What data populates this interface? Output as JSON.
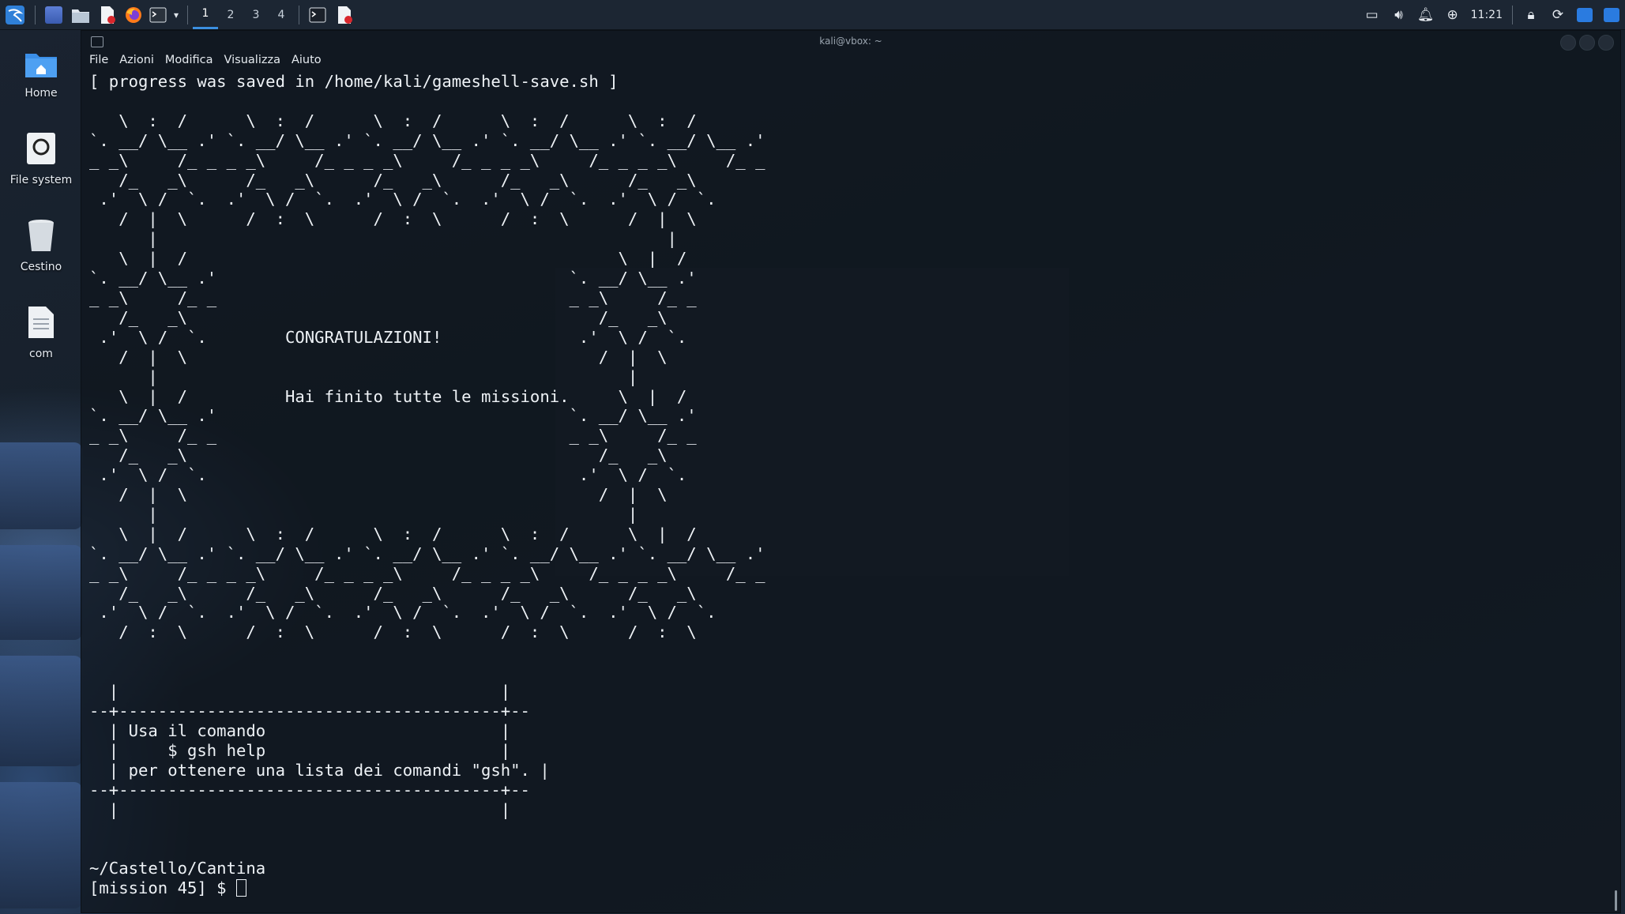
{
  "panel": {
    "workspaces": [
      "1",
      "2",
      "3",
      "4"
    ],
    "active_workspace": "1",
    "clock": "11:21",
    "launchers": [
      "kali-menu-icon",
      "show-desktop-icon",
      "file-manager-icon",
      "text-editor-icon",
      "firefox-icon",
      "terminal-icon"
    ],
    "tray_icons": [
      "display-icon",
      "volume-icon",
      "notification-bell-icon",
      "update-icon",
      "lock-icon",
      "refresh-icon",
      "tray-app-icon",
      "tray-app-icon-2"
    ]
  },
  "desktop": {
    "icons": [
      {
        "label": "Home",
        "icon": "home-folder-icon"
      },
      {
        "label": "File system",
        "icon": "file-system-icon"
      },
      {
        "label": "Cestino",
        "icon": "trash-icon"
      },
      {
        "label": "com",
        "icon": "text-file-icon"
      }
    ]
  },
  "terminal": {
    "title": "kali@vbox: ~",
    "menu": [
      "File",
      "Azioni",
      "Modifica",
      "Visualizza",
      "Aiuto"
    ],
    "lines": [
      "[ progress was saved in /home/kali/gameshell-save.sh ]",
      "",
      "   \\  :  /      \\  :  /      \\  :  /      \\  :  /      \\  :  /",
      "`. __/ \\__ .' `. __/ \\__ .' `. __/ \\__ .' `. __/ \\__ .' `. __/ \\__ .'",
      "_ _\\     /_ _ _ _\\     /_ _ _ _\\     /_ _ _ _\\     /_ _ _ _\\     /_ _",
      "   /_   _\\      /_   _\\      /_   _\\      /_   _\\      /_   _\\",
      " .'  \\ /  `.  .'  \\ /  `.  .'  \\ /  `.  .'  \\ /  `.  .'  \\ /  `.",
      "   /  |  \\      /  :  \\      /  :  \\      /  :  \\      /  |  \\",
      "      |                                                    |",
      "   \\  |  /                                            \\  |  /",
      "`. __/ \\__ .'                                    `. __/ \\__ .'",
      "_ _\\     /_ _                                    _ _\\     /_ _",
      "   /_   _\\                                          /_   _\\",
      " .'  \\ /  `.        CONGRATULAZIONI!              .'  \\ /  `.",
      "   /  |  \\                                          /  |  \\",
      "      |                                                |",
      "   \\  |  /          Hai finito tutte le missioni.     \\  |  /",
      "`. __/ \\__ .'                                    `. __/ \\__ .'",
      "_ _\\     /_ _                                    _ _\\     /_ _",
      "   /_   _\\                                          /_   _\\",
      " .'  \\ /  `.                                      .'  \\ /  `.",
      "   /  |  \\                                          /  |  \\",
      "      |                                                |",
      "   \\  |  /      \\  :  /      \\  :  /      \\  :  /      \\  |  /",
      "`. __/ \\__ .' `. __/ \\__ .' `. __/ \\__ .' `. __/ \\__ .' `. __/ \\__ .'",
      "_ _\\     /_ _ _ _\\     /_ _ _ _\\     /_ _ _ _\\     /_ _ _ _\\     /_ _",
      "   /_   _\\      /_   _\\      /_   _\\      /_   _\\      /_   _\\",
      " .'  \\ /  `.  .'  \\ /  `.  .'  \\ /  `.  .'  \\ /  `.  .'  \\ /  `.",
      "   /  :  \\      /  :  \\      /  :  \\      /  :  \\      /  :  \\",
      "",
      "",
      "  |                                       |",
      "--+---------------------------------------+--",
      "  | Usa il comando                        |",
      "  |     $ gsh help                        |",
      "  | per ottenere una lista dei comandi \"gsh\". |",
      "--+---------------------------------------+--",
      "  |                                       |",
      "",
      "",
      "~/Castello/Cantina"
    ],
    "prompt": "[mission 45] $ "
  }
}
